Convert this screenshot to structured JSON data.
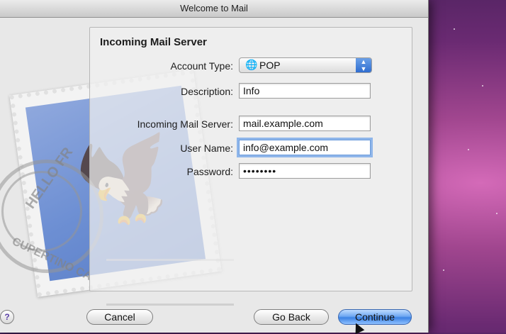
{
  "window": {
    "title": "Welcome to Mail"
  },
  "panel": {
    "title": "Incoming Mail Server",
    "fields": {
      "account_type": {
        "label": "Account Type:",
        "value": "POP",
        "icon": "globe-icon"
      },
      "description": {
        "label": "Description:",
        "value": "Info"
      },
      "incoming_server": {
        "label": "Incoming Mail Server:",
        "value": "mail.example.com"
      },
      "user_name": {
        "label": "User Name:",
        "value": "info@example.com"
      },
      "password": {
        "label": "Password:",
        "value": "••••••••"
      }
    }
  },
  "stamp": {
    "postmark_top": "HELLO FR",
    "postmark_bottom": "CUPERTINO CA"
  },
  "buttons": {
    "help": "?",
    "cancel": "Cancel",
    "go_back": "Go Back",
    "continue": "Continue"
  },
  "colors": {
    "accent": "#3b82e4",
    "desktop": "#a1468f"
  }
}
